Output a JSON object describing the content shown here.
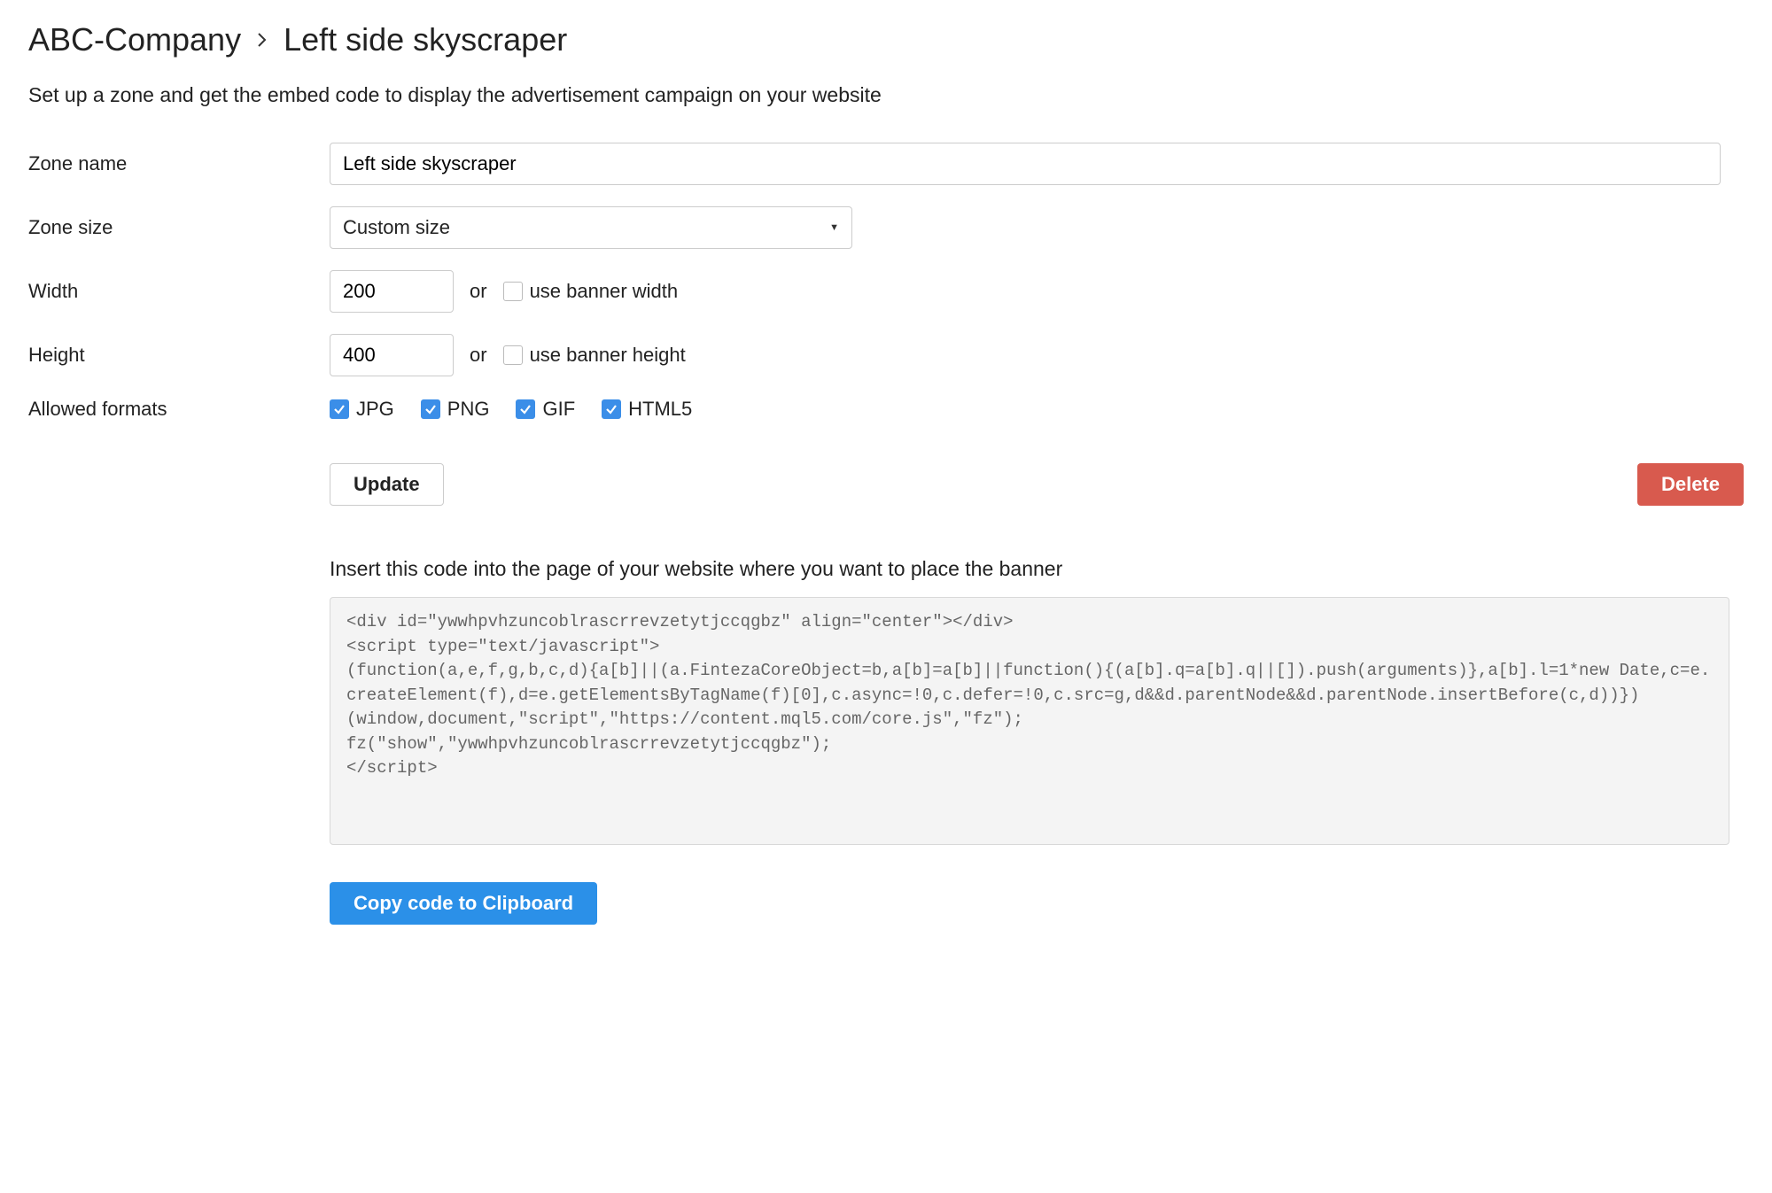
{
  "breadcrumb": {
    "company": "ABC-Company",
    "zone": "Left side skyscraper"
  },
  "subtitle": "Set up a zone and get the embed code to display the advertisement campaign on your website",
  "form": {
    "zone_name_label": "Zone name",
    "zone_name_value": "Left side skyscraper",
    "zone_size_label": "Zone size",
    "zone_size_value": "Custom size",
    "width_label": "Width",
    "width_value": "200",
    "height_label": "Height",
    "height_value": "400",
    "or_text": "or",
    "use_banner_width": "use banner width",
    "use_banner_height": "use banner height",
    "allowed_formats_label": "Allowed formats",
    "formats": {
      "jpg": "JPG",
      "png": "PNG",
      "gif": "GIF",
      "html5": "HTML5"
    }
  },
  "buttons": {
    "update": "Update",
    "delete": "Delete",
    "copy": "Copy code to Clipboard"
  },
  "insert_label": "Insert this code into the page of your website where you want to place the banner",
  "embed_code": "<div id=\"ywwhpvhzuncoblrascrrevzetytjccqgbz\" align=\"center\"></div>\n<script type=\"text/javascript\">\n(function(a,e,f,g,b,c,d){a[b]||(a.FintezaCoreObject=b,a[b]=a[b]||function(){(a[b].q=a[b].q||[]).push(arguments)},a[b].l=1*new Date,c=e.createElement(f),d=e.getElementsByTagName(f)[0],c.async=!0,c.defer=!0,c.src=g,d&&d.parentNode&&d.parentNode.insertBefore(c,d))})\n(window,document,\"script\",\"https://content.mql5.com/core.js\",\"fz\");\nfz(\"show\",\"ywwhpvhzuncoblrascrrevzetytjccqgbz\");\n</script>"
}
